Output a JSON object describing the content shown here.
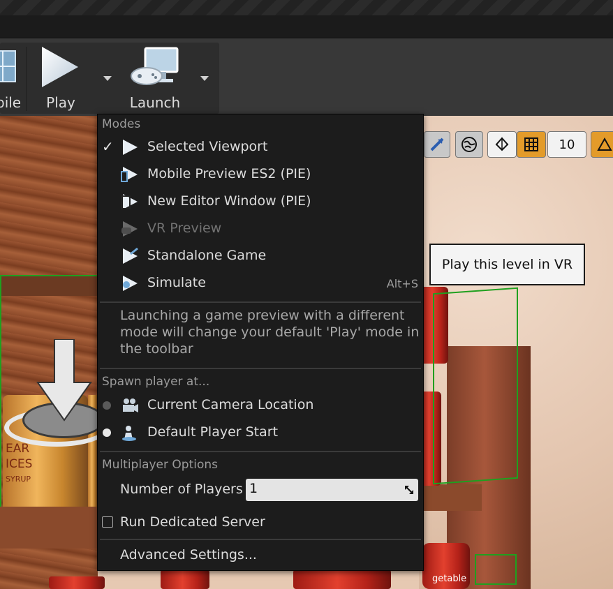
{
  "toolbar": {
    "mobile_label_partial": "bile",
    "play_label": "Play",
    "launch_label": "Launch"
  },
  "viewport_toolbar": {
    "grid_snap_value": "10"
  },
  "scene": {
    "can_label_lines": [
      "EAR",
      "ICES",
      "SYRUP"
    ],
    "can_label_bottom": "getable"
  },
  "menu": {
    "modes_header": "Modes",
    "modes": [
      {
        "label": "Selected Viewport",
        "checked": true,
        "enabled": true,
        "icon": "play-triangle-icon"
      },
      {
        "label": "Mobile Preview ES2 (PIE)",
        "checked": false,
        "enabled": true,
        "icon": "mobile-preview-icon"
      },
      {
        "label": "New Editor Window (PIE)",
        "checked": false,
        "enabled": true,
        "icon": "editor-window-icon"
      },
      {
        "label": "VR Preview",
        "checked": false,
        "enabled": false,
        "icon": "vr-preview-icon"
      },
      {
        "label": "Standalone Game",
        "checked": false,
        "enabled": true,
        "icon": "standalone-game-icon"
      },
      {
        "label": "Simulate",
        "checked": false,
        "enabled": true,
        "icon": "simulate-icon",
        "shortcut": "Alt+S"
      }
    ],
    "modes_description": "Launching a game preview with a different mode will change your default 'Play' mode in the toolbar",
    "spawn_header": "Spawn player at...",
    "spawn_options": [
      {
        "label": "Current Camera Location",
        "selected": false,
        "icon": "camera-icon"
      },
      {
        "label": "Default Player Start",
        "selected": true,
        "icon": "player-start-icon"
      }
    ],
    "multiplayer_header": "Multiplayer Options",
    "number_of_players_label": "Number of Players",
    "number_of_players_value": "1",
    "dedicated_server_label": "Run Dedicated Server",
    "dedicated_server_checked": false,
    "advanced_settings_label": "Advanced Settings..."
  },
  "tooltip": {
    "text": "Play this level in VR"
  },
  "colors": {
    "menu_bg": "#1c1c1c",
    "accent_orange": "#e39b2a",
    "play_icon": "#ffffff"
  }
}
